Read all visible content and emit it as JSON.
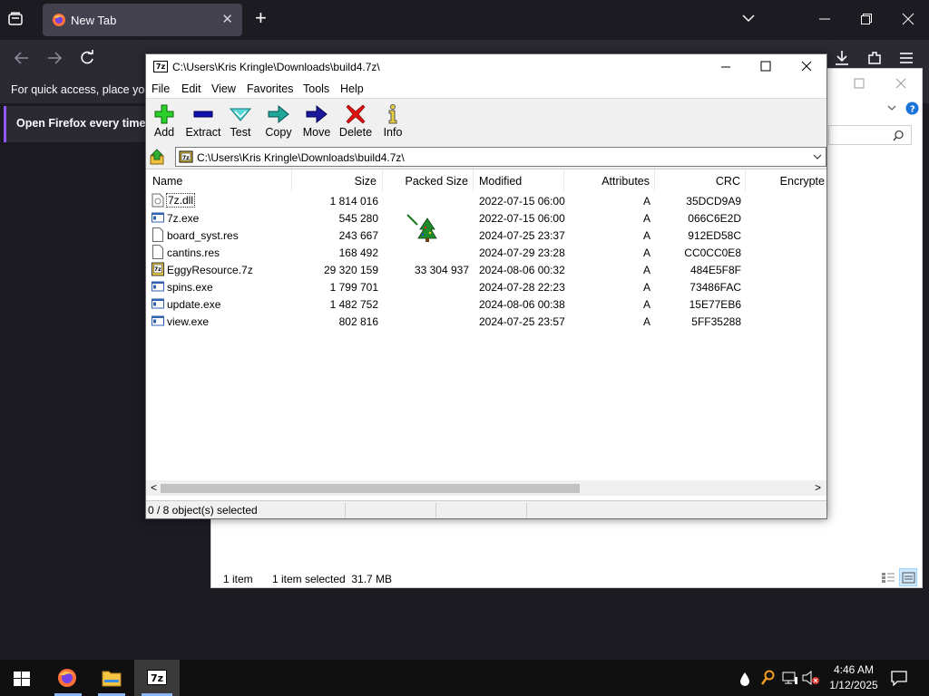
{
  "browser": {
    "tab_title": "New Tab",
    "tab_close": "✕",
    "new_tab": "+",
    "bookmarks_hint": "For quick access, place your",
    "notice": "Open Firefox every time y"
  },
  "explorer": {
    "items_count": "1 item",
    "selected_info": "1 item selected  31.7 MB"
  },
  "sevenzip": {
    "title": "C:\\Users\\Kris Kringle\\Downloads\\build4.7z\\",
    "logo": "7z",
    "menu": [
      "File",
      "Edit",
      "View",
      "Favorites",
      "Tools",
      "Help"
    ],
    "toolbar": [
      "Add",
      "Extract",
      "Test",
      "Copy",
      "Move",
      "Delete",
      "Info"
    ],
    "address": "C:\\Users\\Kris Kringle\\Downloads\\build4.7z\\",
    "columns": [
      "Name",
      "Size",
      "Packed Size",
      "Modified",
      "Attributes",
      "CRC",
      "Encrypte"
    ],
    "files": [
      {
        "name": "7z.dll",
        "size": "1 814 016",
        "packed": "",
        "modified": "2022-07-15 06:00",
        "attr": "A",
        "crc": "35DCD9A9",
        "icon": "dll-icon"
      },
      {
        "name": "7z.exe",
        "size": "545 280",
        "packed": "",
        "modified": "2022-07-15 06:00",
        "attr": "A",
        "crc": "066C6E2D",
        "icon": "exe-icon"
      },
      {
        "name": "board_syst.res",
        "size": "243 667",
        "packed": "",
        "modified": "2024-07-25 23:37",
        "attr": "A",
        "crc": "912ED58C",
        "icon": "file-icon"
      },
      {
        "name": "cantins.res",
        "size": "168 492",
        "packed": "",
        "modified": "2024-07-29 23:28",
        "attr": "A",
        "crc": "CC0CC0E8",
        "icon": "file-icon"
      },
      {
        "name": "EggyResource.7z",
        "size": "29 320 159",
        "packed": "33 304 937",
        "modified": "2024-08-06 00:32",
        "attr": "A",
        "crc": "484E5F8F",
        "icon": "archive-icon"
      },
      {
        "name": "spins.exe",
        "size": "1 799 701",
        "packed": "",
        "modified": "2024-07-28 22:23",
        "attr": "A",
        "crc": "73486FAC",
        "icon": "exe-icon"
      },
      {
        "name": "update.exe",
        "size": "1 482 752",
        "packed": "",
        "modified": "2024-08-06 00:38",
        "attr": "A",
        "crc": "15E77EB6",
        "icon": "exe-icon"
      },
      {
        "name": "view.exe",
        "size": "802 816",
        "packed": "",
        "modified": "2024-07-25 23:57",
        "attr": "A",
        "crc": "5FF35288",
        "icon": "exe-icon"
      }
    ],
    "status": "0 / 8 object(s) selected",
    "scroll_left": "<",
    "scroll_right": ">"
  },
  "taskbar": {
    "time": "4:46 AM",
    "date": "1/12/2025",
    "logo_7z": "7z"
  }
}
